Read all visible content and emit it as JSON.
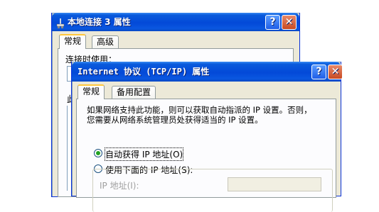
{
  "back_window": {
    "title": "本地连接 3 属性",
    "tabs": [
      "常规",
      "高级"
    ],
    "partial_text": "连接时使用：",
    "partial_char": "此"
  },
  "front_window": {
    "title": "Internet 协议 (TCP/IP) 属性",
    "tabs": [
      "常规",
      "备用配置"
    ],
    "description_line1": "如果网络支持此功能，则可以获取自动指派的 IP 设置。否则，",
    "description_line2": "您需要从网络系统管理员处获得适当的 IP 设置。",
    "radio_auto_ip": "自动获得 IP 地址(O)",
    "radio_manual_ip": "使用下面的 IP 地址(S):",
    "ip_address_label": "IP 地址(I):"
  },
  "title_buttons": {
    "help": "?",
    "close": "✕"
  }
}
